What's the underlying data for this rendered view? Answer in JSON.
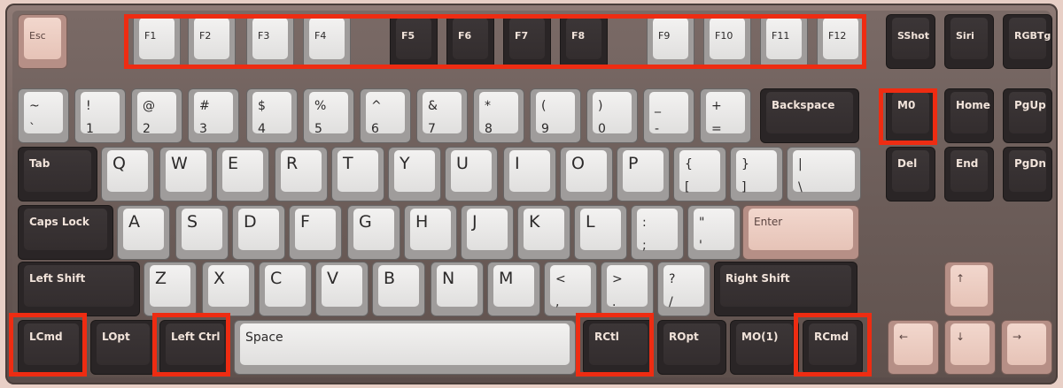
{
  "row_fn": [
    {
      "label": "Esc",
      "style": "pink"
    },
    {
      "label": "F1",
      "style": "light"
    },
    {
      "label": "F2",
      "style": "light"
    },
    {
      "label": "F3",
      "style": "light"
    },
    {
      "label": "F4",
      "style": "light"
    },
    {
      "label": "F5",
      "style": "dark"
    },
    {
      "label": "F6",
      "style": "dark"
    },
    {
      "label": "F7",
      "style": "dark"
    },
    {
      "label": "F8",
      "style": "dark"
    },
    {
      "label": "F9",
      "style": "light"
    },
    {
      "label": "F10",
      "style": "light"
    },
    {
      "label": "F11",
      "style": "light"
    },
    {
      "label": "F12",
      "style": "light"
    },
    {
      "label": "SShot",
      "style": "dark"
    },
    {
      "label": "Siri",
      "style": "dark"
    },
    {
      "label": "RGBTg",
      "style": "dark"
    }
  ],
  "row_num": [
    {
      "top": "~",
      "bottom": "`"
    },
    {
      "top": "!",
      "bottom": "1"
    },
    {
      "top": "@",
      "bottom": "2"
    },
    {
      "top": "#",
      "bottom": "3"
    },
    {
      "top": "$",
      "bottom": "4"
    },
    {
      "top": "%",
      "bottom": "5"
    },
    {
      "top": "^",
      "bottom": "6"
    },
    {
      "top": "&",
      "bottom": "7"
    },
    {
      "top": "*",
      "bottom": "8"
    },
    {
      "top": "(",
      "bottom": "9"
    },
    {
      "top": ")",
      "bottom": "0"
    },
    {
      "top": "_",
      "bottom": "-"
    },
    {
      "top": "+",
      "bottom": "="
    },
    {
      "top": "Backspace",
      "bottom": ""
    },
    {
      "top": "M0",
      "bottom": ""
    },
    {
      "top": "Home",
      "bottom": ""
    },
    {
      "top": "PgUp",
      "bottom": ""
    }
  ],
  "row_tab": [
    {
      "top": "Tab",
      "bottom": ""
    },
    {
      "top": "Q",
      "bottom": ""
    },
    {
      "top": "W",
      "bottom": ""
    },
    {
      "top": "E",
      "bottom": ""
    },
    {
      "top": "R",
      "bottom": ""
    },
    {
      "top": "T",
      "bottom": ""
    },
    {
      "top": "Y",
      "bottom": ""
    },
    {
      "top": "U",
      "bottom": ""
    },
    {
      "top": "I",
      "bottom": ""
    },
    {
      "top": "O",
      "bottom": ""
    },
    {
      "top": "P",
      "bottom": ""
    },
    {
      "top": "{",
      "bottom": "["
    },
    {
      "top": "}",
      "bottom": "]"
    },
    {
      "top": "|",
      "bottom": "\\"
    },
    {
      "top": "Del",
      "bottom": ""
    },
    {
      "top": "End",
      "bottom": ""
    },
    {
      "top": "PgDn",
      "bottom": ""
    }
  ],
  "row_caps": [
    {
      "top": "Caps Lock",
      "bottom": ""
    },
    {
      "top": "A",
      "bottom": ""
    },
    {
      "top": "S",
      "bottom": ""
    },
    {
      "top": "D",
      "bottom": ""
    },
    {
      "top": "F",
      "bottom": ""
    },
    {
      "top": "G",
      "bottom": ""
    },
    {
      "top": "H",
      "bottom": ""
    },
    {
      "top": "J",
      "bottom": ""
    },
    {
      "top": "K",
      "bottom": ""
    },
    {
      "top": "L",
      "bottom": ""
    },
    {
      "top": ":",
      "bottom": ";"
    },
    {
      "top": "\"",
      "bottom": "'"
    },
    {
      "top": "Enter",
      "bottom": ""
    }
  ],
  "row_shift": [
    {
      "top": "Left Shift",
      "bottom": ""
    },
    {
      "top": "Z",
      "bottom": ""
    },
    {
      "top": "X",
      "bottom": ""
    },
    {
      "top": "C",
      "bottom": ""
    },
    {
      "top": "V",
      "bottom": ""
    },
    {
      "top": "B",
      "bottom": ""
    },
    {
      "top": "N",
      "bottom": ""
    },
    {
      "top": "M",
      "bottom": ""
    },
    {
      "top": "<",
      "bottom": ","
    },
    {
      "top": ">",
      "bottom": "."
    },
    {
      "top": "?",
      "bottom": "/"
    },
    {
      "top": "Right Shift",
      "bottom": ""
    },
    {
      "top": "↑",
      "bottom": ""
    }
  ],
  "row_bottom": [
    {
      "top": "LCmd",
      "bottom": ""
    },
    {
      "top": "LOpt",
      "bottom": ""
    },
    {
      "top": "Left Ctrl",
      "bottom": ""
    },
    {
      "top": "Space",
      "bottom": ""
    },
    {
      "top": "RCtl",
      "bottom": ""
    },
    {
      "top": "ROpt",
      "bottom": ""
    },
    {
      "top": "MO(1)",
      "bottom": ""
    },
    {
      "top": "RCmd",
      "bottom": ""
    },
    {
      "top": "←",
      "bottom": ""
    },
    {
      "top": "↓",
      "bottom": ""
    },
    {
      "top": "→",
      "bottom": ""
    }
  ],
  "colors": {
    "highlight": "#ee2c12",
    "dark_key": "#3c3637",
    "light_key": "#f3f2f1",
    "pink_key": "#f2d7cd"
  }
}
